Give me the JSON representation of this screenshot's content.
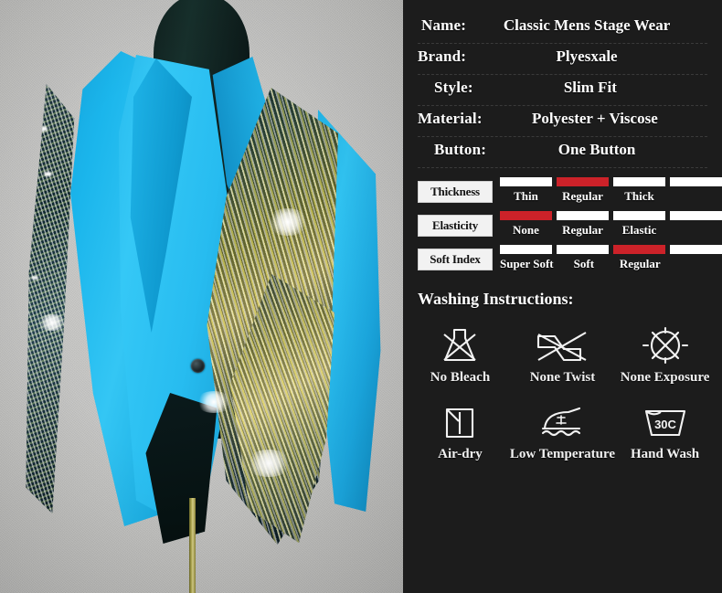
{
  "product_photo": {
    "alt": "Cyan blue sequin blazer on dark mannequin",
    "colors": {
      "jacket_cyan": "#29bdf0",
      "sequin_gold": "#c9c071",
      "sequin_dark": "#163540",
      "mannequin": "#0d1d1b",
      "backdrop": "#c3c3c1",
      "stand_brass": "#b3ac52"
    }
  },
  "specs": [
    {
      "key": "Name:",
      "value": "Classic  Mens  Stage  Wear"
    },
    {
      "key": "Brand:",
      "value": "Plyesxale"
    },
    {
      "key": "Style:",
      "value": "Slim  Fit"
    },
    {
      "key": "Material:",
      "value": "Polyester + Viscose"
    },
    {
      "key": "Button:",
      "value": "One   Button"
    }
  ],
  "ratings": [
    {
      "label": "Thickness",
      "segments": 4,
      "selected_index": 1,
      "ticks": [
        "Thin",
        "Regular",
        "Thick"
      ]
    },
    {
      "label": "Elasticity",
      "segments": 4,
      "selected_index": 0,
      "ticks": [
        "None",
        "Regular",
        "Elastic"
      ]
    },
    {
      "label": "Soft Index",
      "segments": 4,
      "selected_index": 2,
      "ticks": [
        "Super Soft",
        "Soft",
        "Regular"
      ]
    }
  ],
  "rating_colors": {
    "active": "#cc2229",
    "inactive": "#ffffff"
  },
  "washing": {
    "title": "Washing Instructions:",
    "items": [
      {
        "icon": "no-bleach-icon",
        "caption": "No Bleach"
      },
      {
        "icon": "no-twist-icon",
        "caption": "None Twist"
      },
      {
        "icon": "no-exposure-icon",
        "caption": "None Exposure"
      },
      {
        "icon": "air-dry-icon",
        "caption": "Air-dry"
      },
      {
        "icon": "low-temperature-iron-icon",
        "caption": "Low Temperature",
        "iron_mark": "低"
      },
      {
        "icon": "hand-wash-icon",
        "caption": "Hand Wash",
        "temp": "30C"
      }
    ]
  },
  "panel_background": "#1c1c1c"
}
